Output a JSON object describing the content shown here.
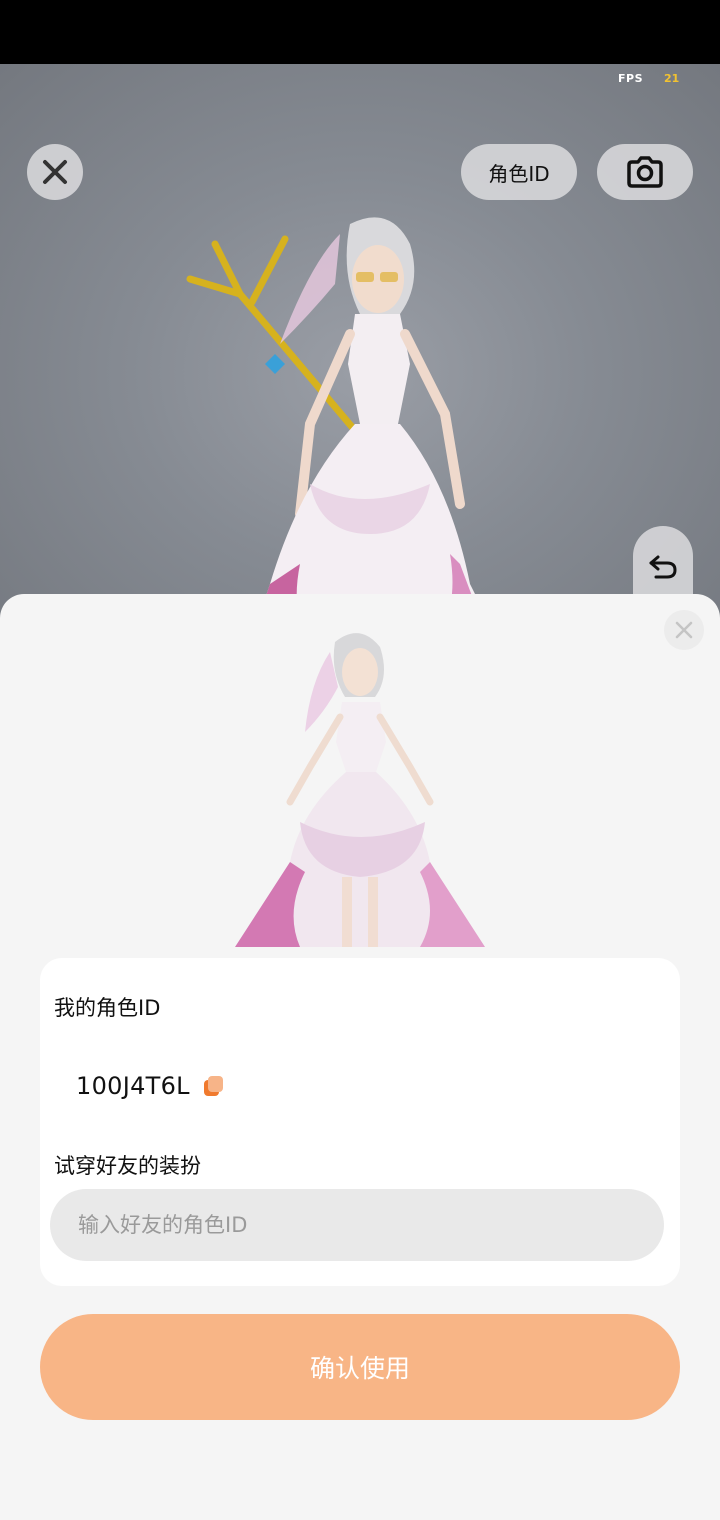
{
  "viewer": {
    "fps_label": "FPS",
    "fps_value": "21",
    "role_id_button": "角色ID"
  },
  "panel": {
    "my_id_label": "我的角色ID",
    "my_id_value": "100J4T6L",
    "try_on_label": "试穿好友的装扮",
    "friend_id_placeholder": "输入好友的角色ID",
    "friend_id_value": "",
    "confirm_button": "确认使用"
  },
  "colors": {
    "accent": "#f8b586",
    "copy_icon": "#f07a2e",
    "fps_value": "#f2c230"
  },
  "icons": [
    "close-icon",
    "camera-icon",
    "undo-icon",
    "copy-icon"
  ]
}
